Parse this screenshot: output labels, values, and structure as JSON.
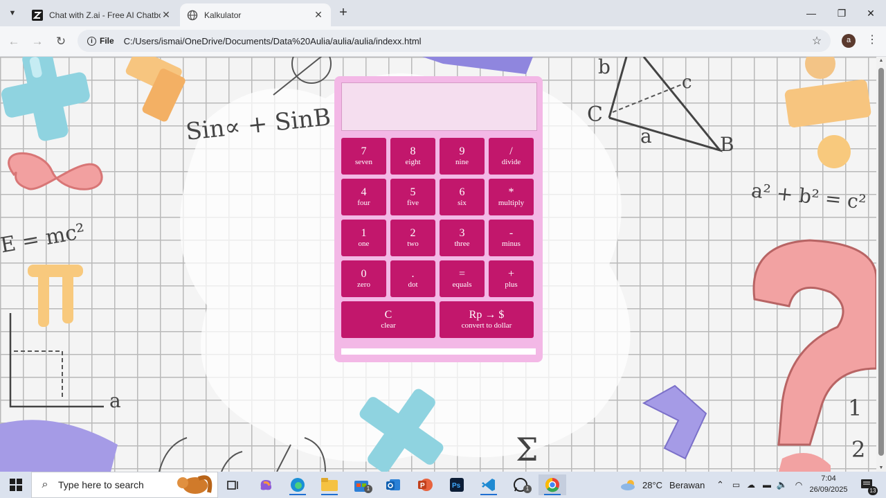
{
  "browser": {
    "tabs": [
      {
        "title": "Chat with Z.ai - Free AI Chatbot",
        "icon": "zai-logo-icon"
      },
      {
        "title": "Kalkulator",
        "icon": "globe-icon"
      }
    ],
    "scheme_chip": "File",
    "url": "C:/Users/ismai/OneDrive/Documents/Data%20Aulia/aulia/aulia/indexx.html",
    "profile_initial": "a"
  },
  "calculator": {
    "display_value": "",
    "keys": [
      {
        "symbol": "7",
        "label": "seven"
      },
      {
        "symbol": "8",
        "label": "eight"
      },
      {
        "symbol": "9",
        "label": "nine"
      },
      {
        "symbol": "/",
        "label": "divide"
      },
      {
        "symbol": "4",
        "label": "four"
      },
      {
        "symbol": "5",
        "label": "five"
      },
      {
        "symbol": "6",
        "label": "six"
      },
      {
        "symbol": "*",
        "label": "multiply"
      },
      {
        "symbol": "1",
        "label": "one"
      },
      {
        "symbol": "2",
        "label": "two"
      },
      {
        "symbol": "3",
        "label": "three"
      },
      {
        "symbol": "-",
        "label": "minus"
      },
      {
        "symbol": "0",
        "label": "zero"
      },
      {
        "symbol": ".",
        "label": "dot"
      },
      {
        "symbol": "=",
        "label": "equals"
      },
      {
        "symbol": "+",
        "label": "plus"
      },
      {
        "symbol": "C",
        "label": "clear"
      },
      {
        "symbol": "Rp → $",
        "label": "convert to dollar"
      }
    ],
    "colors": {
      "panel": "#f3b8e6",
      "key": "#c2176c",
      "display": "#f5deef"
    }
  },
  "background_text": {
    "formula_sin": "Sin∝ + SinB",
    "formula_emc": "E = mc²",
    "formula_pyth": "a² + b² = c²",
    "tri_b": "b",
    "tri_c_lower": "c",
    "tri_c_upper": "C",
    "tri_a": "a",
    "tri_B": "B",
    "axis_a": "a",
    "fraction_num": "1",
    "fraction_den": "2",
    "sigma": "Σ"
  },
  "taskbar": {
    "search_placeholder": "Type here to search",
    "weather_temp": "28°C",
    "weather_desc": "Berawan",
    "time": "7:04",
    "date": "26/09/2025",
    "badges": {
      "store": "1",
      "whatsapp": "1",
      "notifications": "13"
    }
  }
}
